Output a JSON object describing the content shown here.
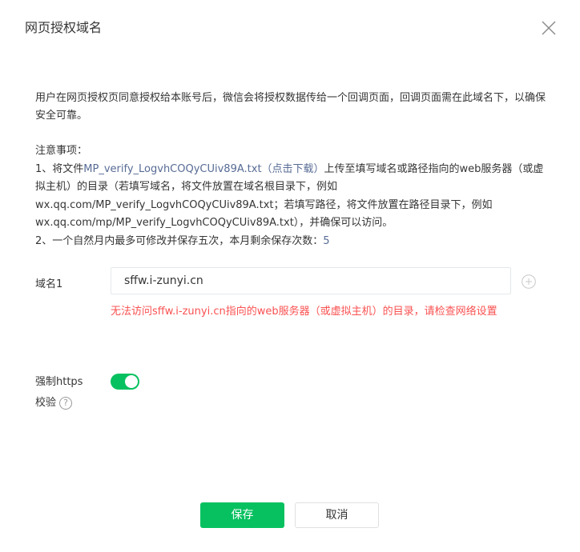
{
  "dialog": {
    "title": "网页授权域名"
  },
  "description": "用户在网页授权页同意授权给本账号后，微信会将授权数据传给一个回调页面，回调页面需在此域名下，以确保安全可靠。",
  "notes": {
    "heading": "注意事项：",
    "item1_prefix": "1、将文件",
    "file_link": "MP_verify_LogvhCOQyCUiv89A.txt（点击下载）",
    "item1_suffix": "上传至填写域名或路径指向的web服务器（或虚拟主机）的目录（若填写域名，将文件放置在域名根目录下，例如wx.qq.com/MP_verify_LogvhCOQyCUiv89A.txt；若填写路径，将文件放置在路径目录下，例如wx.qq.com/mp/MP_verify_LogvhCOQyCUiv89A.txt），并确保可以访问。",
    "item2_prefix": "2、一个自然月内最多可修改并保存五次，本月剩余保存次数：",
    "remaining_count": "5"
  },
  "domain_field": {
    "label": "域名1",
    "value": "sffw.i-zunyi.cn",
    "error": "无法访问sffw.i-zunyi.cn指向的web服务器（或虚拟主机）的目录，请检查网络设置"
  },
  "https_check": {
    "label_line1": "强制https",
    "label_line2": "校验",
    "help_glyph": "?",
    "enabled": true
  },
  "buttons": {
    "save": "保存",
    "cancel": "取消"
  },
  "colors": {
    "primary": "#07c160",
    "link": "#576b95",
    "error": "#fa5151",
    "text": "#353535"
  },
  "icons": {
    "close": "close-icon",
    "add": "plus-circle-icon",
    "help": "question-circle-icon"
  }
}
